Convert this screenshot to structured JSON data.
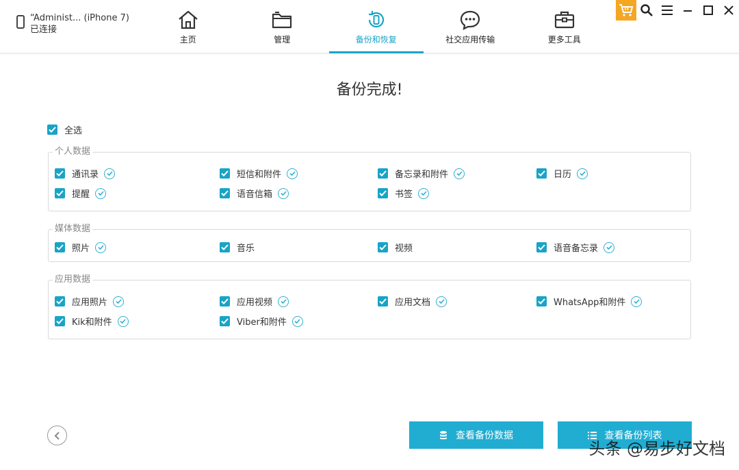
{
  "device": {
    "name": "“Administ... (iPhone 7)",
    "status": "已连接"
  },
  "tabs": [
    {
      "label": "主页",
      "icon": "home-icon"
    },
    {
      "label": "管理",
      "icon": "folder-icon"
    },
    {
      "label": "备份和恢复",
      "icon": "backup-restore-icon",
      "active": true
    },
    {
      "label": "社交应用传输",
      "icon": "chat-icon"
    },
    {
      "label": "更多工具",
      "icon": "toolbox-icon"
    }
  ],
  "title": "备份完成!",
  "select_all": "全选",
  "groups": [
    {
      "legend": "个人数据",
      "items": [
        "通讯录",
        "短信和附件",
        "备忘录和附件",
        "日历",
        "提醒",
        "语音信箱",
        "书签"
      ]
    },
    {
      "legend": "媒体数据",
      "items": [
        "照片",
        "音乐",
        "视频",
        "语音备忘录"
      ]
    },
    {
      "legend": "应用数据",
      "items": [
        "应用照片",
        "应用视频",
        "应用文档",
        "WhatsApp和附件",
        "Kik和附件",
        "Viber和附件"
      ]
    }
  ],
  "buttons": {
    "view_data": "查看备份数据",
    "view_list": "查看备份列表"
  },
  "watermark": "头条 @易步好文档",
  "colors": {
    "accent": "#18a4c7",
    "button": "#21add1",
    "cart": "#f5a623"
  }
}
